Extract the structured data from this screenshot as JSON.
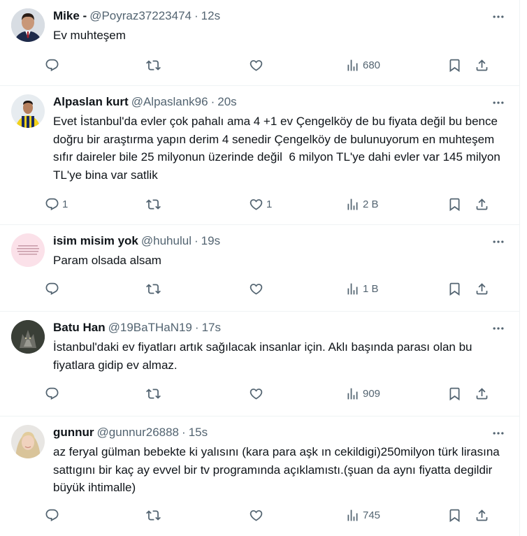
{
  "tweets": [
    {
      "name": "Mike -",
      "handle": "@Poyraz37223474",
      "time": "12s",
      "text": "Ev muhteşem",
      "replies": "",
      "retweets": "",
      "likes": "",
      "views": "680",
      "avatar": "person-suit-avatar"
    },
    {
      "name": "Alpaslan kurt",
      "handle": "@Alpaslank96",
      "time": "20s",
      "text": "Evet İstanbul'da evler çok pahalı ama 4 +1 ev Çengelköy de bu fiyata değil bu bence doğru bir araştırma yapın derim 4 senedir Çengelköy de bulunuyorum en muhteşem sıfır daireler bile 25 milyonun üzerinde değil  6 milyon TL'ye dahi evler var 145 milyon TL'ye bina var satlik",
      "replies": "1",
      "retweets": "",
      "likes": "1",
      "views": "2 B",
      "avatar": "football-jersey-avatar"
    },
    {
      "name": "isim misim yok",
      "handle": "@huhulul",
      "time": "19s",
      "text": "Param olsada alsam",
      "replies": "",
      "retweets": "",
      "likes": "",
      "views": "1 B",
      "avatar": "pink-text-avatar"
    },
    {
      "name": "Batu Han",
      "handle": "@19BaTHaN19",
      "time": "17s",
      "text": "İstanbul'daki ev fiyatları artık sağılacak insanlar için. Aklı başında parası olan bu fiyatlara gidip ev almaz.",
      "replies": "",
      "retweets": "",
      "likes": "",
      "views": "909",
      "avatar": "wolf-avatar"
    },
    {
      "name": "gunnur",
      "handle": "@gunnur26888",
      "time": "15s",
      "text": "az feryal gülman bebekte ki yalısını (kara para aşk ın cekildigi)250milyon türk lirasına sattıgını bir kaç ay evvel bir tv programında açıklamıstı.(şuan da aynı fiyatta degildir büyük ihtimalle)",
      "replies": "",
      "retweets": "",
      "likes": "",
      "views": "745",
      "avatar": "blonde-woman-avatar"
    }
  ],
  "colors": {
    "text": "#0f1419",
    "secondary": "#536471",
    "border": "#eff3f4"
  }
}
